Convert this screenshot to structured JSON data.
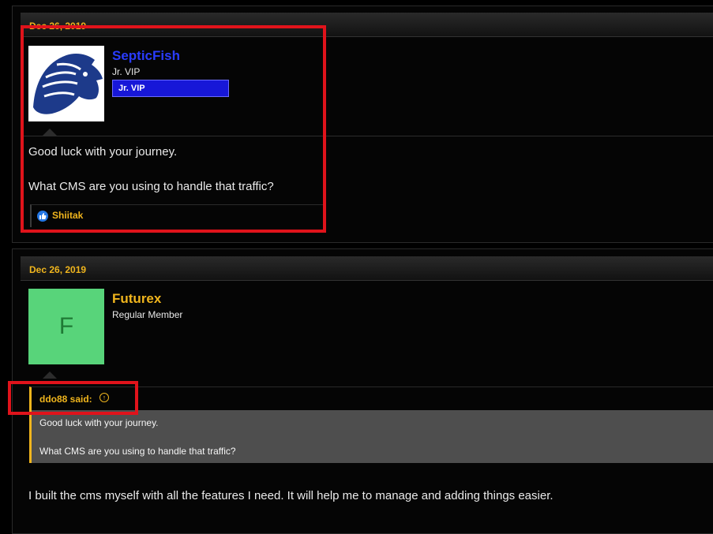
{
  "posts": [
    {
      "date": "Dec 26, 2019",
      "username": "SepticFish",
      "user_title": "Jr. VIP",
      "banner": "Jr. VIP",
      "avatar_icon": "horse-logo-icon",
      "body": [
        "Good luck with your journey.",
        "What CMS are you using to handle that traffic?"
      ],
      "reaction_user": "Shiitak"
    },
    {
      "date": "Dec 26, 2019",
      "username": "Futurex",
      "user_title": "Regular Member",
      "avatar_letter": "F",
      "quote": {
        "author": "ddo88 said:",
        "lines": [
          "Good luck with your journey.",
          "What CMS are you using to handle that traffic?"
        ]
      },
      "body": [
        "I built the cms myself with all the features I need. It will help me to manage and adding things easier."
      ]
    }
  ],
  "colors": {
    "accent": "#f0b51d",
    "username_vip": "#2a3cff",
    "banner_bg": "#1717d8",
    "annotation": "#e0131b",
    "avatar_green": "#58d47a"
  }
}
